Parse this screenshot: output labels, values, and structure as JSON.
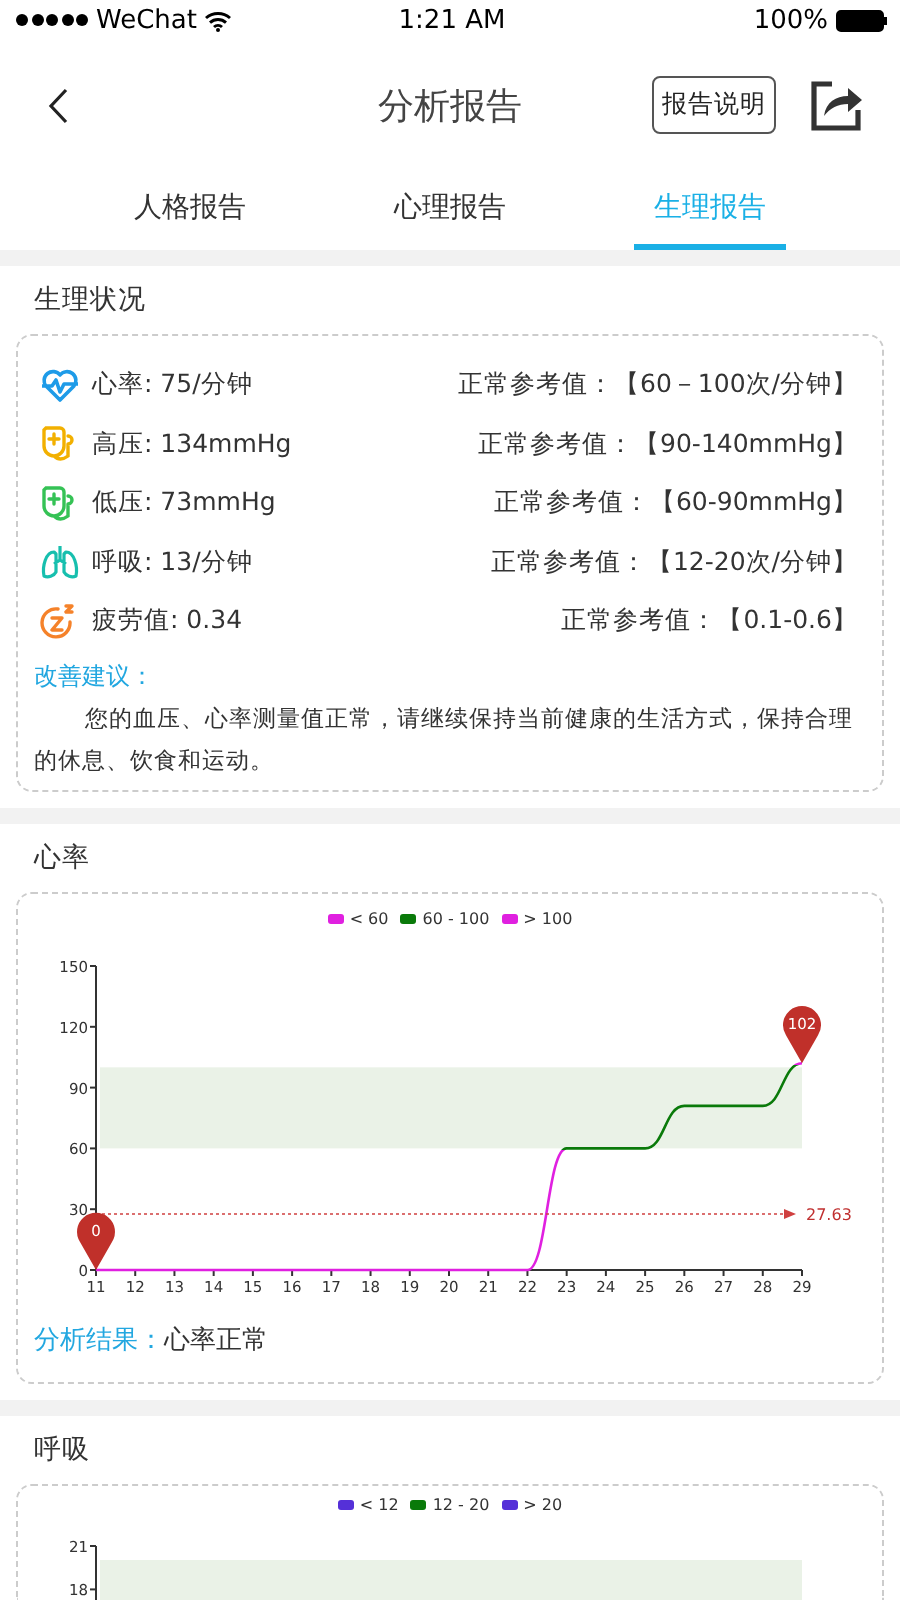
{
  "status_bar": {
    "carrier": "WeChat",
    "time": "1:21 AM",
    "battery": "100%"
  },
  "nav": {
    "title": "分析报告",
    "help_button": "报告说明"
  },
  "tabs": [
    {
      "label": "人格报告",
      "selected": false
    },
    {
      "label": "心理报告",
      "selected": false
    },
    {
      "label": "生理报告",
      "selected": true
    }
  ],
  "status_section": {
    "title": "生理状况",
    "rows": [
      {
        "kind": "heart",
        "label": "心率: 75/分钟",
        "reference": "正常参考值：【60－100次/分钟】"
      },
      {
        "kind": "high_pressure",
        "label": "高压: 134mmHg",
        "reference": "正常参考值：【90-140mmHg】"
      },
      {
        "kind": "low_pressure",
        "label": "低压: 73mmHg",
        "reference": "正常参考值：【60-90mmHg】"
      },
      {
        "kind": "lungs",
        "label": "呼吸: 13/分钟",
        "reference": "正常参考值：【12-20次/分钟】"
      },
      {
        "kind": "fatigue",
        "label": "疲劳值: 0.34",
        "reference": "正常参考值：【0.1-0.6】"
      }
    ],
    "advice_label": "改善建议：",
    "advice": "您的血压、心率测量值正常，请继续保持当前健康的生活方式，保持合理的休息、饮食和运动。"
  },
  "charts": [
    {
      "title": "心率",
      "legend": [
        {
          "label": "< 60",
          "color": "#e020e0"
        },
        {
          "label": "60 - 100",
          "color": "#0a7a0a"
        },
        {
          "label": "> 100",
          "color": "#e020e0"
        }
      ],
      "chart_data": {
        "type": "line",
        "x": [
          11,
          12,
          13,
          14,
          15,
          16,
          17,
          18,
          19,
          20,
          21,
          22,
          23,
          24,
          25,
          26,
          27,
          28,
          29
        ],
        "xlim": [
          11,
          29
        ],
        "xticks": [
          11,
          12,
          13,
          14,
          15,
          16,
          17,
          18,
          19,
          20,
          21,
          22,
          23,
          24,
          25,
          26,
          27,
          28,
          29
        ],
        "ylim": [
          0,
          150
        ],
        "yticks": [
          0,
          30,
          60,
          90,
          120,
          150
        ],
        "series": [
          {
            "values": [
              0,
              0,
              0,
              0,
              0,
              0,
              0,
              0,
              0,
              0,
              0,
              0,
              60,
              60,
              60,
              81,
              81,
              81,
              102
            ]
          }
        ],
        "bands": [
          {
            "axis": "y",
            "from": 60,
            "to": 100
          }
        ],
        "ref_lines": [
          {
            "axis": "y",
            "value": 27.63,
            "label": "27.63"
          }
        ]
      },
      "markers": [
        {
          "kind": "min",
          "label": "0"
        },
        {
          "kind": "max",
          "label": "102"
        }
      ],
      "result_label": "分析结果：",
      "result": "心率正常"
    },
    {
      "title": "呼吸",
      "legend": [
        {
          "label": "< 12",
          "color": "#5530d8"
        },
        {
          "label": "12 - 20",
          "color": "#0a7a0a"
        },
        {
          "label": "> 20",
          "color": "#5530d8"
        }
      ],
      "axis_labels": [
        "21",
        "18"
      ]
    }
  ]
}
